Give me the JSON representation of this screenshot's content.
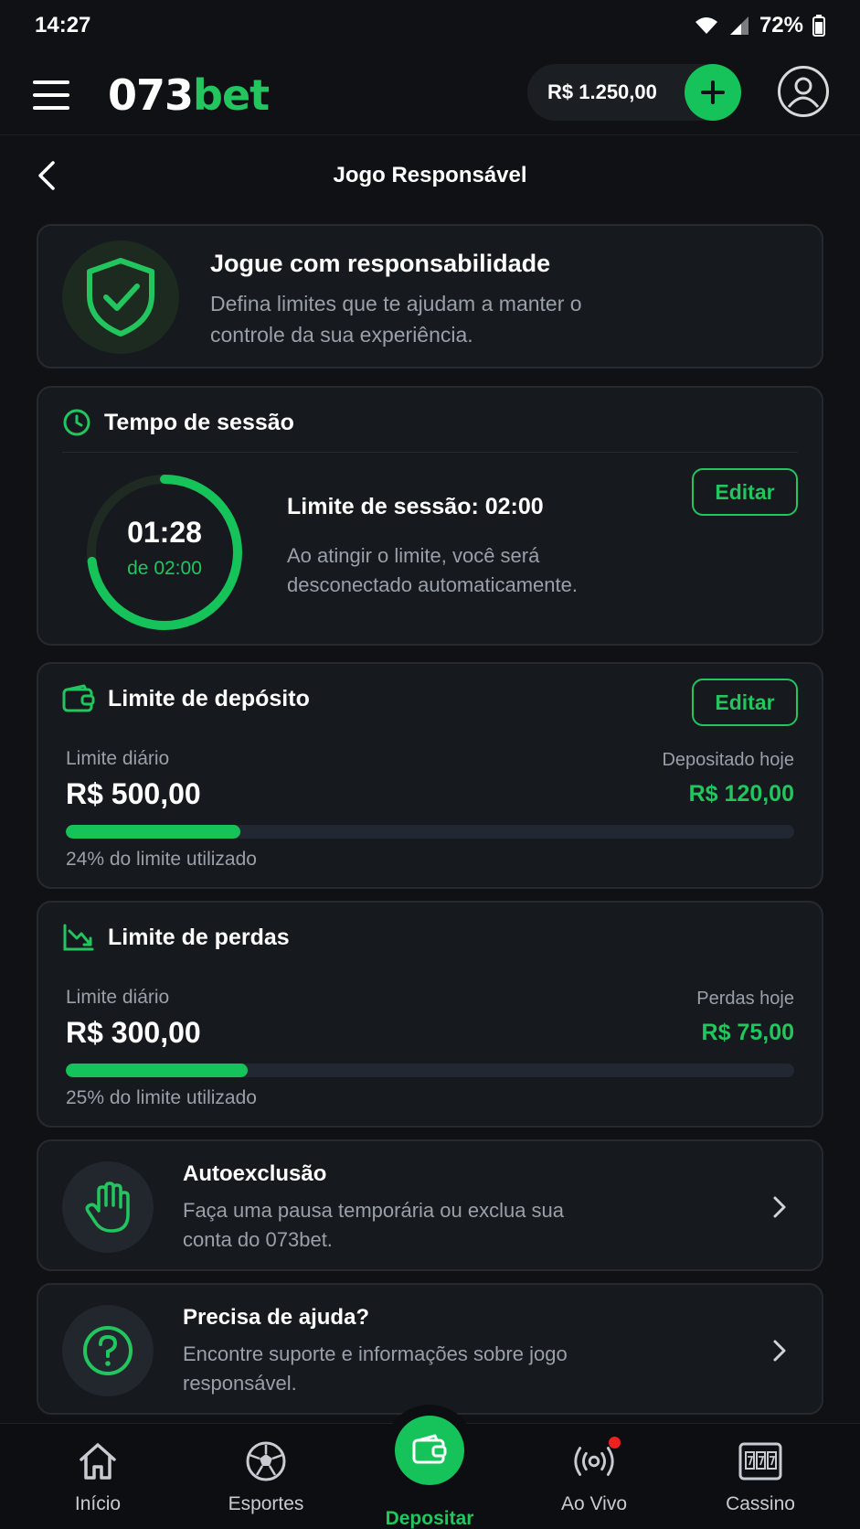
{
  "status_bar": {
    "time": "14:27",
    "battery": "72%"
  },
  "header": {
    "logo_main": "073",
    "logo_accent": "bet",
    "balance": "R$ 1.250,00",
    "icons": {
      "menu": "menu-icon",
      "add": "plus-icon",
      "profile": "user-icon"
    }
  },
  "page": {
    "title": "Jogo Responsável"
  },
  "intro": {
    "title": "Jogue com responsabilidade",
    "description": "Defina limites que te ajudam a manter o controle da sua experiência."
  },
  "session": {
    "title": "Tempo de sessão",
    "elapsed": "01:28",
    "of_limit": "de 02:00",
    "progress": 0.73,
    "limit_text": "Limite de sessão: 02:00",
    "description": "Ao atingir o limite, você será desconectado automaticamente.",
    "edit_label": "Editar"
  },
  "deposit": {
    "title": "Limite de depósito",
    "edit_label": "Editar",
    "limit_label": "Limite diário",
    "limit_value": "R$ 500,00",
    "today_label": "Depositado hoje",
    "today_value": "R$ 120,00",
    "progress": 0.24,
    "caption": "24% do limite utilizado"
  },
  "loss": {
    "title": "Limite de perdas",
    "limit_label": "Limite diário",
    "limit_value": "R$ 300,00",
    "today_label": "Perdas hoje",
    "today_value": "R$ 75,00",
    "progress": 0.25,
    "caption": "25% do limite utilizado"
  },
  "self_exclusion": {
    "title": "Autoexclusão",
    "description": "Faça uma pausa temporária ou exclua sua conta do 073bet."
  },
  "help": {
    "title": "Precisa de ajuda?",
    "description": "Encontre suporte e informações sobre jogo responsável."
  },
  "bottom_nav": {
    "items": [
      {
        "label": "Início",
        "icon": "home-icon"
      },
      {
        "label": "Esportes",
        "icon": "soccer-ball-icon"
      },
      {
        "label": "Depositar",
        "icon": "wallet-icon"
      },
      {
        "label": "Ao Vivo",
        "icon": "live-broadcast-icon"
      },
      {
        "label": "Cassino",
        "icon": "slot-machine-icon"
      }
    ]
  },
  "colors": {
    "accent": "#22c55e",
    "background": "#0f1114",
    "card": "#16191d",
    "live_dot": "#ef2020"
  }
}
